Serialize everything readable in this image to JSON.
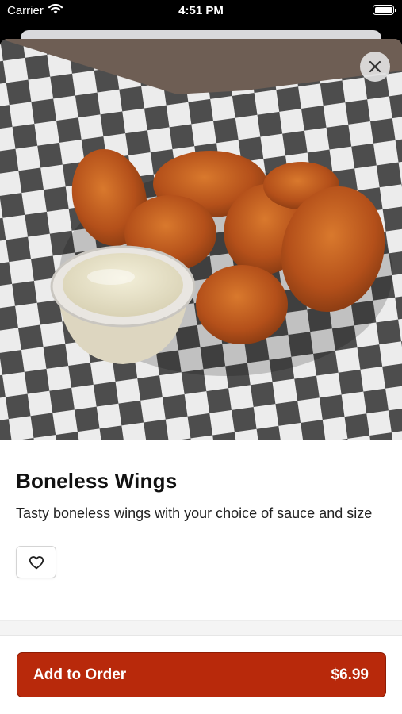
{
  "status_bar": {
    "carrier": "Carrier",
    "time": "4:51 PM",
    "icons": [
      "wifi-icon",
      "battery-icon"
    ]
  },
  "item": {
    "image_alt": "Boneless Wings",
    "title": "Boneless Wings",
    "description": "Tasty boneless wings with your choice of sauce and size",
    "favorite_icon": "heart-outline-icon",
    "close_icon": "close-icon"
  },
  "order_button": {
    "label": "Add to Order",
    "price": "$6.99"
  },
  "colors": {
    "accent": "#b8290b",
    "close_button_bg": "#e1e1e1"
  }
}
